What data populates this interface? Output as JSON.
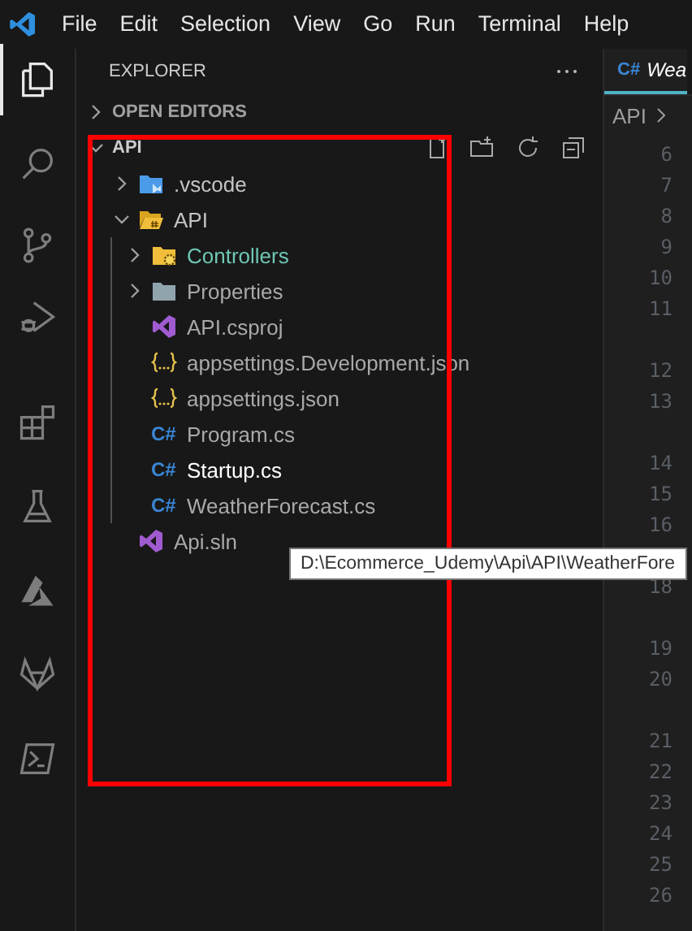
{
  "menu": [
    "File",
    "Edit",
    "Selection",
    "View",
    "Go",
    "Run",
    "Terminal",
    "Help"
  ],
  "activity_bar": [
    {
      "kind": "explorer",
      "selected": true
    },
    {
      "kind": "search",
      "selected": false
    },
    {
      "kind": "source-control",
      "selected": false
    },
    {
      "kind": "run-debug",
      "selected": false
    },
    {
      "kind": "extensions",
      "selected": false
    },
    {
      "kind": "testing",
      "selected": false
    },
    {
      "kind": "azure",
      "selected": false
    },
    {
      "kind": "gitlab",
      "selected": false
    },
    {
      "kind": "powershell",
      "selected": false
    }
  ],
  "sidebar": {
    "title": "EXPLORER",
    "sections": [
      {
        "title": "OPEN EDITORS",
        "expanded": false,
        "actions": false
      },
      {
        "title": "API",
        "expanded": true,
        "actions": true
      }
    ],
    "tree": [
      {
        "label": ".vscode",
        "kind": "vscode-folder",
        "expanded": false,
        "color": "#c5c5c5"
      },
      {
        "label": "API",
        "kind": "api-folder",
        "expanded": true,
        "color": "#c5c5c5",
        "children": [
          {
            "label": "Controllers",
            "kind": "controllers-folder",
            "expanded": false,
            "color": "#6fc7b5"
          },
          {
            "label": "Properties",
            "kind": "folder",
            "expanded": false,
            "color": "#a9a9a9"
          },
          {
            "label": "API.csproj",
            "kind": "csproj",
            "color": "#a9a9a9"
          },
          {
            "label": "appsettings.Development.json",
            "kind": "json",
            "color": "#a9a9a9"
          },
          {
            "label": "appsettings.json",
            "kind": "json",
            "color": "#a9a9a9"
          },
          {
            "label": "Program.cs",
            "kind": "csharp",
            "icon_text": "C#",
            "color": "#a9a9a9"
          },
          {
            "label": "Startup.cs",
            "kind": "csharp",
            "icon_text": "C#",
            "color": "#ffffff"
          },
          {
            "label": "WeatherForecast.cs",
            "kind": "csharp",
            "icon_text": "C#",
            "color": "#a9a9a9"
          }
        ]
      },
      {
        "label": "Api.sln",
        "kind": "sln",
        "color": "#a9a9a9"
      }
    ]
  },
  "editor": {
    "tab": {
      "icon_text": "C#",
      "label": "Wea",
      "selected": true
    },
    "breadcrumb": [
      "API"
    ],
    "line_numbers": [
      {
        "text": "6",
        "wrapped": false
      },
      {
        "text": "7",
        "wrapped": false
      },
      {
        "text": "8",
        "wrapped": false
      },
      {
        "text": "9",
        "wrapped": false
      },
      {
        "text": "10",
        "wrapped": false
      },
      {
        "text": "11",
        "wrapped": true
      },
      {
        "text": "12",
        "wrapped": false
      },
      {
        "text": "13",
        "wrapped": true
      },
      {
        "text": "14",
        "wrapped": false
      },
      {
        "text": "15",
        "wrapped": false
      },
      {
        "text": "16",
        "wrapped": true
      },
      {
        "text": "18",
        "wrapped": true
      },
      {
        "text": "19",
        "wrapped": false
      },
      {
        "text": "20",
        "wrapped": true
      },
      {
        "text": "21",
        "wrapped": false
      },
      {
        "text": "22",
        "wrapped": false
      },
      {
        "text": "23",
        "wrapped": false
      },
      {
        "text": "24",
        "wrapped": false
      },
      {
        "text": "25",
        "wrapped": false
      },
      {
        "text": "26",
        "wrapped": false
      }
    ]
  },
  "tooltip": {
    "text": "D:\\Ecommerce_Udemy\\Api\\API\\WeatherFore"
  }
}
